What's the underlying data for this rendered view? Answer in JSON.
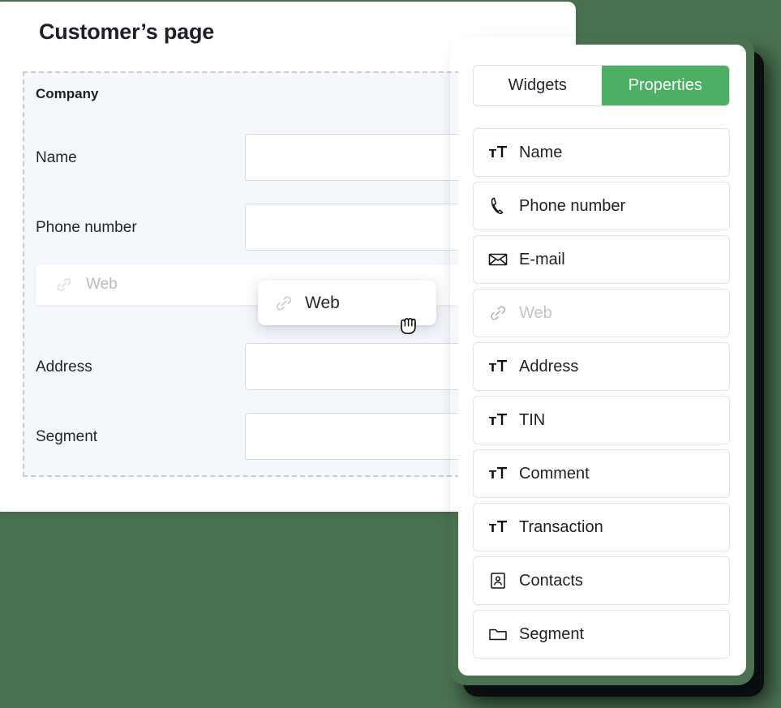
{
  "colors": {
    "background": "#4a7251",
    "accent_green": "#4caf64",
    "card_white": "#ffffff",
    "section_fill": "#f4f7fc",
    "dashed_border": "#c9ccd2",
    "muted_text": "#b6bac1"
  },
  "customer_card": {
    "title": "Customer’s page",
    "section": {
      "heading": "Company",
      "fields": [
        {
          "label": "Name",
          "value": "",
          "icon": ""
        },
        {
          "label": "Phone number",
          "value": "",
          "icon": ""
        },
        {
          "label": "Address",
          "value": "",
          "icon": ""
        },
        {
          "label": "Segment",
          "value": "",
          "icon": ""
        }
      ],
      "drop_target": {
        "label": "Web",
        "icon": "link-icon",
        "state": "placeholder"
      }
    }
  },
  "drag": {
    "chip_label": "Web",
    "chip_icon": "link-icon",
    "cursor": "grabbing-hand-cursor"
  },
  "properties_panel": {
    "tabs": [
      {
        "label": "Widgets",
        "active": false
      },
      {
        "label": "Properties",
        "active": true
      }
    ],
    "items": [
      {
        "label": "Name",
        "icon": "text-size-icon",
        "dimmed": false
      },
      {
        "label": "Phone number",
        "icon": "phone-icon",
        "dimmed": false
      },
      {
        "label": "E-mail",
        "icon": "envelope-icon",
        "dimmed": false
      },
      {
        "label": "Web",
        "icon": "link-icon",
        "dimmed": true
      },
      {
        "label": "Address",
        "icon": "text-size-icon",
        "dimmed": false
      },
      {
        "label": "TIN",
        "icon": "text-size-icon",
        "dimmed": false
      },
      {
        "label": "Comment",
        "icon": "text-size-icon",
        "dimmed": false
      },
      {
        "label": "Transaction",
        "icon": "text-size-icon",
        "dimmed": false
      },
      {
        "label": "Contacts",
        "icon": "contact-card-icon",
        "dimmed": false
      },
      {
        "label": "Segment",
        "icon": "folder-icon",
        "dimmed": false
      }
    ]
  }
}
